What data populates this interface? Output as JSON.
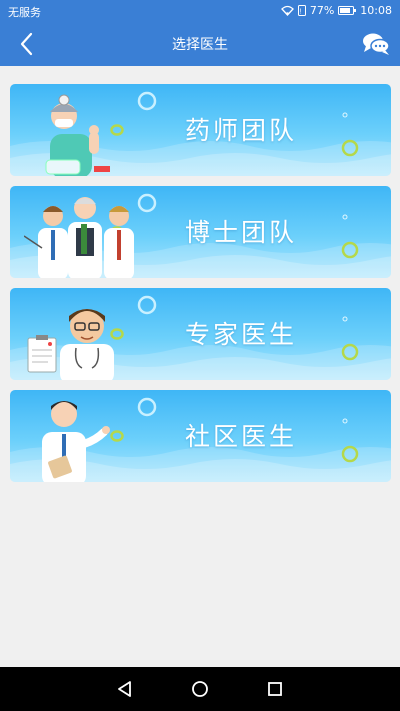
{
  "status_bar": {
    "carrier": "无服务",
    "battery": "77%",
    "time": "10:08"
  },
  "app_bar": {
    "title": "选择医生",
    "back_icon": "chevron-left-icon",
    "chat_icon": "chat-bubbles-icon"
  },
  "cards": [
    {
      "label": "药师团队",
      "icon": "pharmacist-illustration"
    },
    {
      "label": "博士团队",
      "icon": "doctor-team-illustration"
    },
    {
      "label": "专家医生",
      "icon": "expert-doctor-illustration"
    },
    {
      "label": "社区医生",
      "icon": "community-doctor-illustration"
    }
  ],
  "colors": {
    "header": "#3a7fd5",
    "card_top": "#3fb6f6",
    "card_bottom": "#aee6fd",
    "ring_green": "#b5d84a",
    "background": "#f0f0f0"
  },
  "nav_bar": {
    "back": "triangle-back-icon",
    "home": "circle-home-icon",
    "recents": "square-recents-icon"
  }
}
